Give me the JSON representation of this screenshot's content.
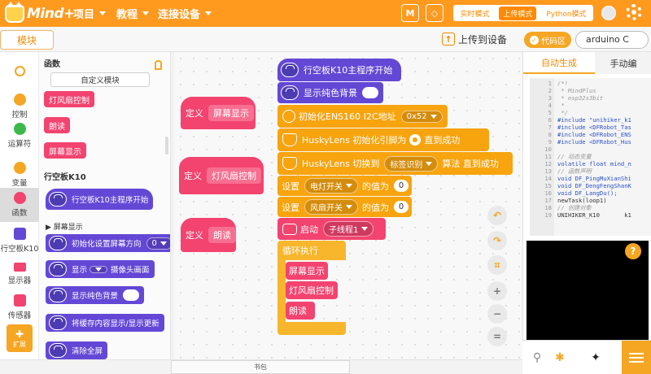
{
  "app": {
    "name": "Mind+"
  },
  "menu": {
    "project": "项目",
    "tutorial": "教程",
    "connect": "连接设备"
  },
  "modes": {
    "realtime": "实时模式",
    "upload": "上传模式",
    "python": "Python模式"
  },
  "toolbar": {
    "module_tab": "模块",
    "upload_label": "上传到设备",
    "code_area": "代码区",
    "board": "arduino C"
  },
  "categories": [
    {
      "label": "控制",
      "color": "#f5a623"
    },
    {
      "label": "运算符",
      "color": "#3cb94a"
    },
    {
      "label": "变量",
      "color": "#f5a623"
    },
    {
      "label": "函数",
      "color": "#f3436f"
    },
    {
      "label": "行空板K10",
      "color": "#6348d6"
    },
    {
      "label": "显示器",
      "color": "#f3436f"
    },
    {
      "label": "传感器",
      "color": "#f3436f"
    }
  ],
  "extension": {
    "label": "扩展"
  },
  "palette": {
    "functions_heading": "函数",
    "custom_module_btn": "自定义模块",
    "func_blocks": [
      "灯风扇控制",
      "朗读",
      "屏幕显示"
    ],
    "k10_heading": "行空板K10",
    "k10_start": "行空板K10主程序开始",
    "screen_sub": "屏幕显示",
    "init_dir_label": "初始化设置屏幕方向",
    "init_dir_value": "0",
    "display_label": "显示",
    "display_value": "摄像头画面",
    "bg_label": "显示纯色背景",
    "cache_label": "将缓存内容显示/显示更新",
    "clear_label": "清除全屏"
  },
  "defs": [
    {
      "prefix": "定义",
      "name": "屏幕显示"
    },
    {
      "prefix": "定义",
      "name": "灯风扇控制"
    },
    {
      "prefix": "定义",
      "name": "朗读"
    }
  ],
  "script": {
    "start": "行空板K10主程序开始",
    "bg": "显示纯色背景",
    "ens_label": "初始化ENS160 I2C地址",
    "ens_addr": "0x52",
    "husky1_pre": "HuskyLens 初始化引脚为",
    "husky1_post": "直到成功",
    "husky2_pre": "HuskyLens 切换到",
    "husky2_value": "标签识别",
    "husky2_post": "算法 直到成功",
    "set": "设置",
    "light_switch": "电灯开关",
    "fan_switch": "风扇开关",
    "value_of": "的值为",
    "light_val": "0",
    "fan_val": "0",
    "launch": "启动",
    "thread": "子线程1",
    "loop": "循环执行",
    "calls": [
      "屏幕显示",
      "灯风扇控制",
      "朗读"
    ]
  },
  "right_panel": {
    "tab_auto": "自动生成",
    "tab_manual": "手动编",
    "code_lines": [
      {
        "t": "/*!",
        "c": "cmt"
      },
      {
        "t": " * MindPlus",
        "c": "cmt"
      },
      {
        "t": " * esp32s3bit",
        "c": "cmt"
      },
      {
        "t": " *",
        "c": "cmt"
      },
      {
        "t": " */",
        "c": "cmt"
      },
      {
        "t": "#include \"unihiker_k1",
        "c": "kw"
      },
      {
        "t": "#include <DFRobot_Tas",
        "c": "kw"
      },
      {
        "t": "#include <DFRobot_ENS",
        "c": "kw"
      },
      {
        "t": "#include <DFRobot_Hus",
        "c": "kw"
      },
      {
        "t": "",
        "c": "plain"
      },
      {
        "t": "// 动态变量",
        "c": "cmt"
      },
      {
        "t": "volatile float mind_n",
        "c": "kw"
      },
      {
        "t": "// 函数声明",
        "c": "cmt"
      },
      {
        "t": "void DF_PingMuXianShi",
        "c": "kw"
      },
      {
        "t": "void DF_DengFengShanK",
        "c": "kw"
      },
      {
        "t": "void DF_LangDu();",
        "c": "kw"
      },
      {
        "t": "newTask(loop1)",
        "c": "plain"
      },
      {
        "t": "// 创建对象",
        "c": "cmt"
      },
      {
        "t": "UNIHIKER_K10       k1",
        "c": "plain"
      }
    ],
    "line_numbers": [
      "1",
      "2",
      "3",
      "4",
      "5",
      "6",
      "7",
      "8",
      "9",
      "10",
      "11",
      "12",
      "13",
      "14",
      "15",
      "16",
      "17",
      "18",
      "19"
    ]
  },
  "bottom": {
    "bag": "书包"
  },
  "colors": {
    "accent": "#ff9a1f",
    "function_pink": "#f3436f",
    "k10_purple": "#6348d6",
    "sensor_orange": "#f7a40f",
    "control_yellow": "#f8b62c"
  }
}
